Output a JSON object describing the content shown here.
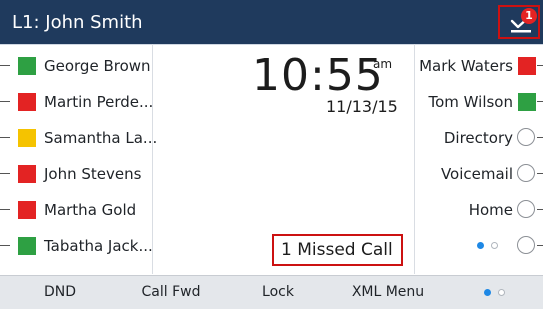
{
  "header": {
    "title": "L1: John Smith",
    "missed_badge_count": "1",
    "background_color": "#1f3a5d",
    "highlight_color": "#cc1111"
  },
  "left_line_keys": [
    {
      "label": "George Brown",
      "status_color": "#2ea043",
      "status": "available"
    },
    {
      "label": "Martin Perde...",
      "status_color": "#e32323",
      "status": "busy"
    },
    {
      "label": "Samantha La...",
      "status_color": "#f5c300",
      "status": "ringing"
    },
    {
      "label": "John Stevens",
      "status_color": "#e32323",
      "status": "busy"
    },
    {
      "label": "Martha Gold",
      "status_color": "#e32323",
      "status": "busy"
    },
    {
      "label": "Tabatha Jack...",
      "status_color": "#2ea043",
      "status": "available"
    }
  ],
  "right_line_keys": [
    {
      "label": "Mark Waters",
      "status_color": "#e32323",
      "type": "contact",
      "icon": "status-square"
    },
    {
      "label": "Tom Wilson",
      "status_color": "#2ea043",
      "type": "contact",
      "icon": "status-square"
    },
    {
      "label": "Directory",
      "type": "function",
      "icon": "circle"
    },
    {
      "label": "Voicemail",
      "type": "function",
      "icon": "circle"
    },
    {
      "label": "Home",
      "type": "function",
      "icon": "circle"
    },
    {
      "label": "",
      "type": "pager",
      "icon": "circle",
      "page_current": 1,
      "page_total": 2
    }
  ],
  "clock": {
    "time": "10:55",
    "ampm": "am",
    "date": "11/13/15"
  },
  "notification": {
    "missed_calls": "1  Missed Call"
  },
  "softkeys": {
    "items": [
      "DND",
      "Call Fwd",
      "Lock",
      "XML Menu"
    ],
    "page_current": 1,
    "page_total": 2
  },
  "colors": {
    "accent_blue": "#1e88e5",
    "pager_inactive": "#b0b6bd",
    "softkey_bar": "#e4e7eb"
  }
}
